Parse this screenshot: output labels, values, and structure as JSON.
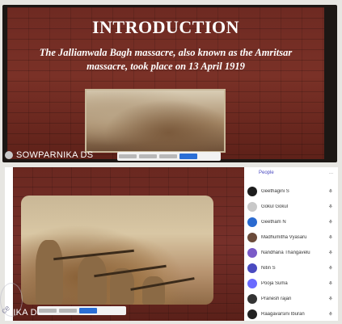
{
  "top_screen": {
    "slide_title": "INTRODUCTION",
    "slide_subtitle_line1": "The Jallianwala Bagh massacre, also known as the Amritsar",
    "slide_subtitle_line2": "massacre, took place on 13 April 1919",
    "presenter_name": "SOWPARNIKA DS"
  },
  "bottom_screen": {
    "presenter_name": "NIKA DS",
    "people_panel": {
      "tab_people": "People",
      "tab_other": "...",
      "participants": [
        {
          "name": "Geethagini S",
          "avatar_color": "#1d1d1d"
        },
        {
          "name": "Gokul Gokul",
          "avatar_color": "#c8c8c8"
        },
        {
          "name": "Geetham N",
          "avatar_color": "#2a6ad0"
        },
        {
          "name": "Madhumitha Vyasaru",
          "avatar_color": "#6b4b3a"
        },
        {
          "name": "Nandhana Thangavelu",
          "avatar_color": "#7a5ac8"
        },
        {
          "name": "Nitin S",
          "avatar_color": "#4a4ac0"
        },
        {
          "name": "Pooja Suma",
          "avatar_color": "#6a6aff"
        },
        {
          "name": "Pranesh rajan",
          "avatar_color": "#333333"
        },
        {
          "name": "Raagavarsini Iburan",
          "avatar_color": "#222222"
        }
      ]
    }
  },
  "stamp_fragment": "ce"
}
